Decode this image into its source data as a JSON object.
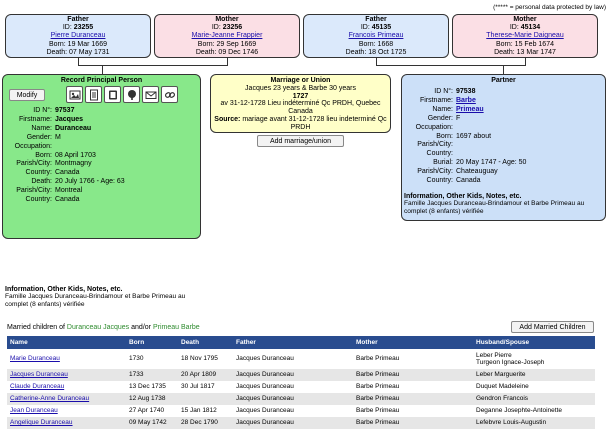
{
  "note": "(***** = personal data protected by law)",
  "parents": {
    "father": {
      "role": "Father",
      "id_label": "ID:",
      "id": "23255",
      "name": "Pierre Duranceau",
      "born": "Born: 19 Mar 1669",
      "death": "Death: 07 May 1731"
    },
    "mother": {
      "role": "Mother",
      "id_label": "ID:",
      "id": "23256",
      "name": "Marie-Jeanne Frappier",
      "born": "Born: 29 Sep 1669",
      "death": "Death: 09 Dec 1746"
    },
    "partner_father": {
      "role": "Father",
      "id_label": "ID:",
      "id": "45135",
      "name": "Francois Primeau",
      "born": "Born: 1668",
      "death": "Death: 18 Oct 1725"
    },
    "partner_mother": {
      "role": "Mother",
      "id_label": "ID:",
      "id": "45134",
      "name": "Therese-Marie Daigneau",
      "born": "Born: 15 Feb 1674",
      "death": "Death: 13 Mar 1747"
    }
  },
  "principal": {
    "title": "Record Principal Person",
    "modify_label": "Modify",
    "tools": [
      "photo-icon",
      "document-icon",
      "notes-icon",
      "tree-icon",
      "mail-icon",
      "link-icon"
    ],
    "fields": [
      {
        "label": "ID N°:",
        "value": "97537",
        "bold": true
      },
      {
        "label": "Firstname:",
        "value": "Jacques",
        "bold": true
      },
      {
        "label": "Name:",
        "value": "Duranceau",
        "bold": true
      },
      {
        "label": "Gender:",
        "value": "M"
      },
      {
        "label": "Occupation:",
        "value": ""
      },
      {
        "label": "Born:",
        "value": "08 April 1703"
      },
      {
        "label": "Parish/City:",
        "value": "Montmagny"
      },
      {
        "label": "Country:",
        "value": "Canada"
      },
      {
        "label": "Death:",
        "value": "20 July 1766 - Age: 63"
      },
      {
        "label": "Parish/City:",
        "value": "Montreal"
      },
      {
        "label": "Country:",
        "value": "Canada"
      }
    ],
    "info_title": "Information, Other Kids, Notes, etc.",
    "info_text": "Famille Jacques Duranceau-Brindamour et Barbe Primeau au complet (8 enfants) vérifiée"
  },
  "marriage": {
    "title": "Marriage or Union",
    "ages": "Jacques 23 years & Barbe 30 years",
    "year": "1727",
    "place": "av 31-12-1728 Lieu indéterminé Qc PRDH, Quebec Canada",
    "source_label": "Source:",
    "source": "mariage avant 31-12-1728 lieu indeterminé Qc PRDH",
    "add_label": "Add marriage/union"
  },
  "partner": {
    "title": "Partner",
    "fields": [
      {
        "label": "ID N°:",
        "value": "97538",
        "bold": true
      },
      {
        "label": "Firstname:",
        "value": "Barbe",
        "link": true
      },
      {
        "label": "Name:",
        "value": "Primeau",
        "link": true
      },
      {
        "label": "Gender:",
        "value": "F"
      },
      {
        "label": "Occupation:",
        "value": ""
      },
      {
        "label": "Born:",
        "value": "1697 about"
      },
      {
        "label": "Parish/City:",
        "value": ""
      },
      {
        "label": "Country:",
        "value": ""
      },
      {
        "label": "Burial:",
        "value": "20 May 1747 - Age: 50"
      },
      {
        "label": "Parish/City:",
        "value": "Chateauguay"
      },
      {
        "label": "Country:",
        "value": "Canada"
      }
    ],
    "info_title": "Information, Other Kids, Notes, etc.",
    "info_text": "Famille Jacques Duranceau-Brindamour et Barbe Primeau au complet (8 enfants) vérifiée"
  },
  "children": {
    "title_prefix": "Married children of",
    "father_name": "Duranceau Jacques",
    "and_or": "and/or",
    "mother_name": "Primeau Barbe",
    "add_label": "Add Married Children",
    "headers": [
      "Name",
      "Born",
      "Death",
      "Father",
      "Mother",
      "Husband/Spouse"
    ],
    "rows": [
      [
        "Marie Duranceau",
        "1730",
        "18 Nov 1795",
        "Jacques Duranceau",
        "Barbe Primeau",
        "Leber Pierre\nTurgeon Ignace-Joseph"
      ],
      [
        "Jacques Duranceau",
        "1733",
        "20 Apr 1809",
        "Jacques Duranceau",
        "Barbe Primeau",
        "Leber Marguerite"
      ],
      [
        "Claude Duranceau",
        "13 Dec 1735",
        "30 Jul 1817",
        "Jacques Duranceau",
        "Barbe Primeau",
        "Duquet Madeleine"
      ],
      [
        "Catherine-Anne Duranceau",
        "12 Aug 1738",
        "",
        "Jacques Duranceau",
        "Barbe Primeau",
        "Gendron Francois"
      ],
      [
        "Jean Duranceau",
        "27 Apr 1740",
        "15 Jan 1812",
        "Jacques Duranceau",
        "Barbe Primeau",
        "Deganne Josephte-Antoinette"
      ],
      [
        "Angelique Duranceau",
        "09 May 1742",
        "28 Dec 1790",
        "Jacques Duranceau",
        "Barbe Primeau",
        "Lefebvre Louis-Augustin"
      ]
    ]
  }
}
